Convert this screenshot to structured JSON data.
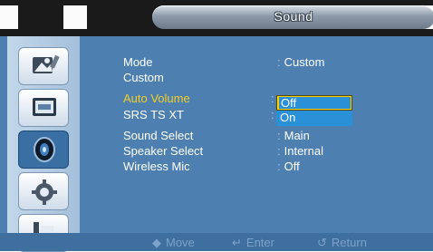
{
  "header": {
    "title": "Sound"
  },
  "sidebar": {
    "icons": [
      {
        "name": "picture-icon"
      },
      {
        "name": "screen-icon"
      },
      {
        "name": "sound-icon",
        "selected": true
      },
      {
        "name": "setup-icon"
      },
      {
        "name": "multi-screen-icon"
      }
    ]
  },
  "menu": {
    "rows": [
      {
        "label": "Mode",
        "value": "Custom"
      },
      {
        "label": "Custom",
        "value": ""
      },
      {
        "label": "Auto Volume",
        "value": "Off",
        "active": true
      },
      {
        "label": "SRS TS XT",
        "value": ""
      },
      {
        "label": "Sound Select",
        "value": "Main"
      },
      {
        "label": "Speaker Select",
        "value": "Internal"
      },
      {
        "label": "Wireless Mic",
        "value": "Off"
      }
    ],
    "colon": ":"
  },
  "popup": {
    "options": [
      "Off",
      "On"
    ],
    "selected_index": 0
  },
  "footer": {
    "move": "Move",
    "enter": "Enter",
    "return": "Return"
  },
  "colors": {
    "panel": "#4d80b0",
    "highlight": "#f3cd2a",
    "popup": "#2a90d8"
  }
}
